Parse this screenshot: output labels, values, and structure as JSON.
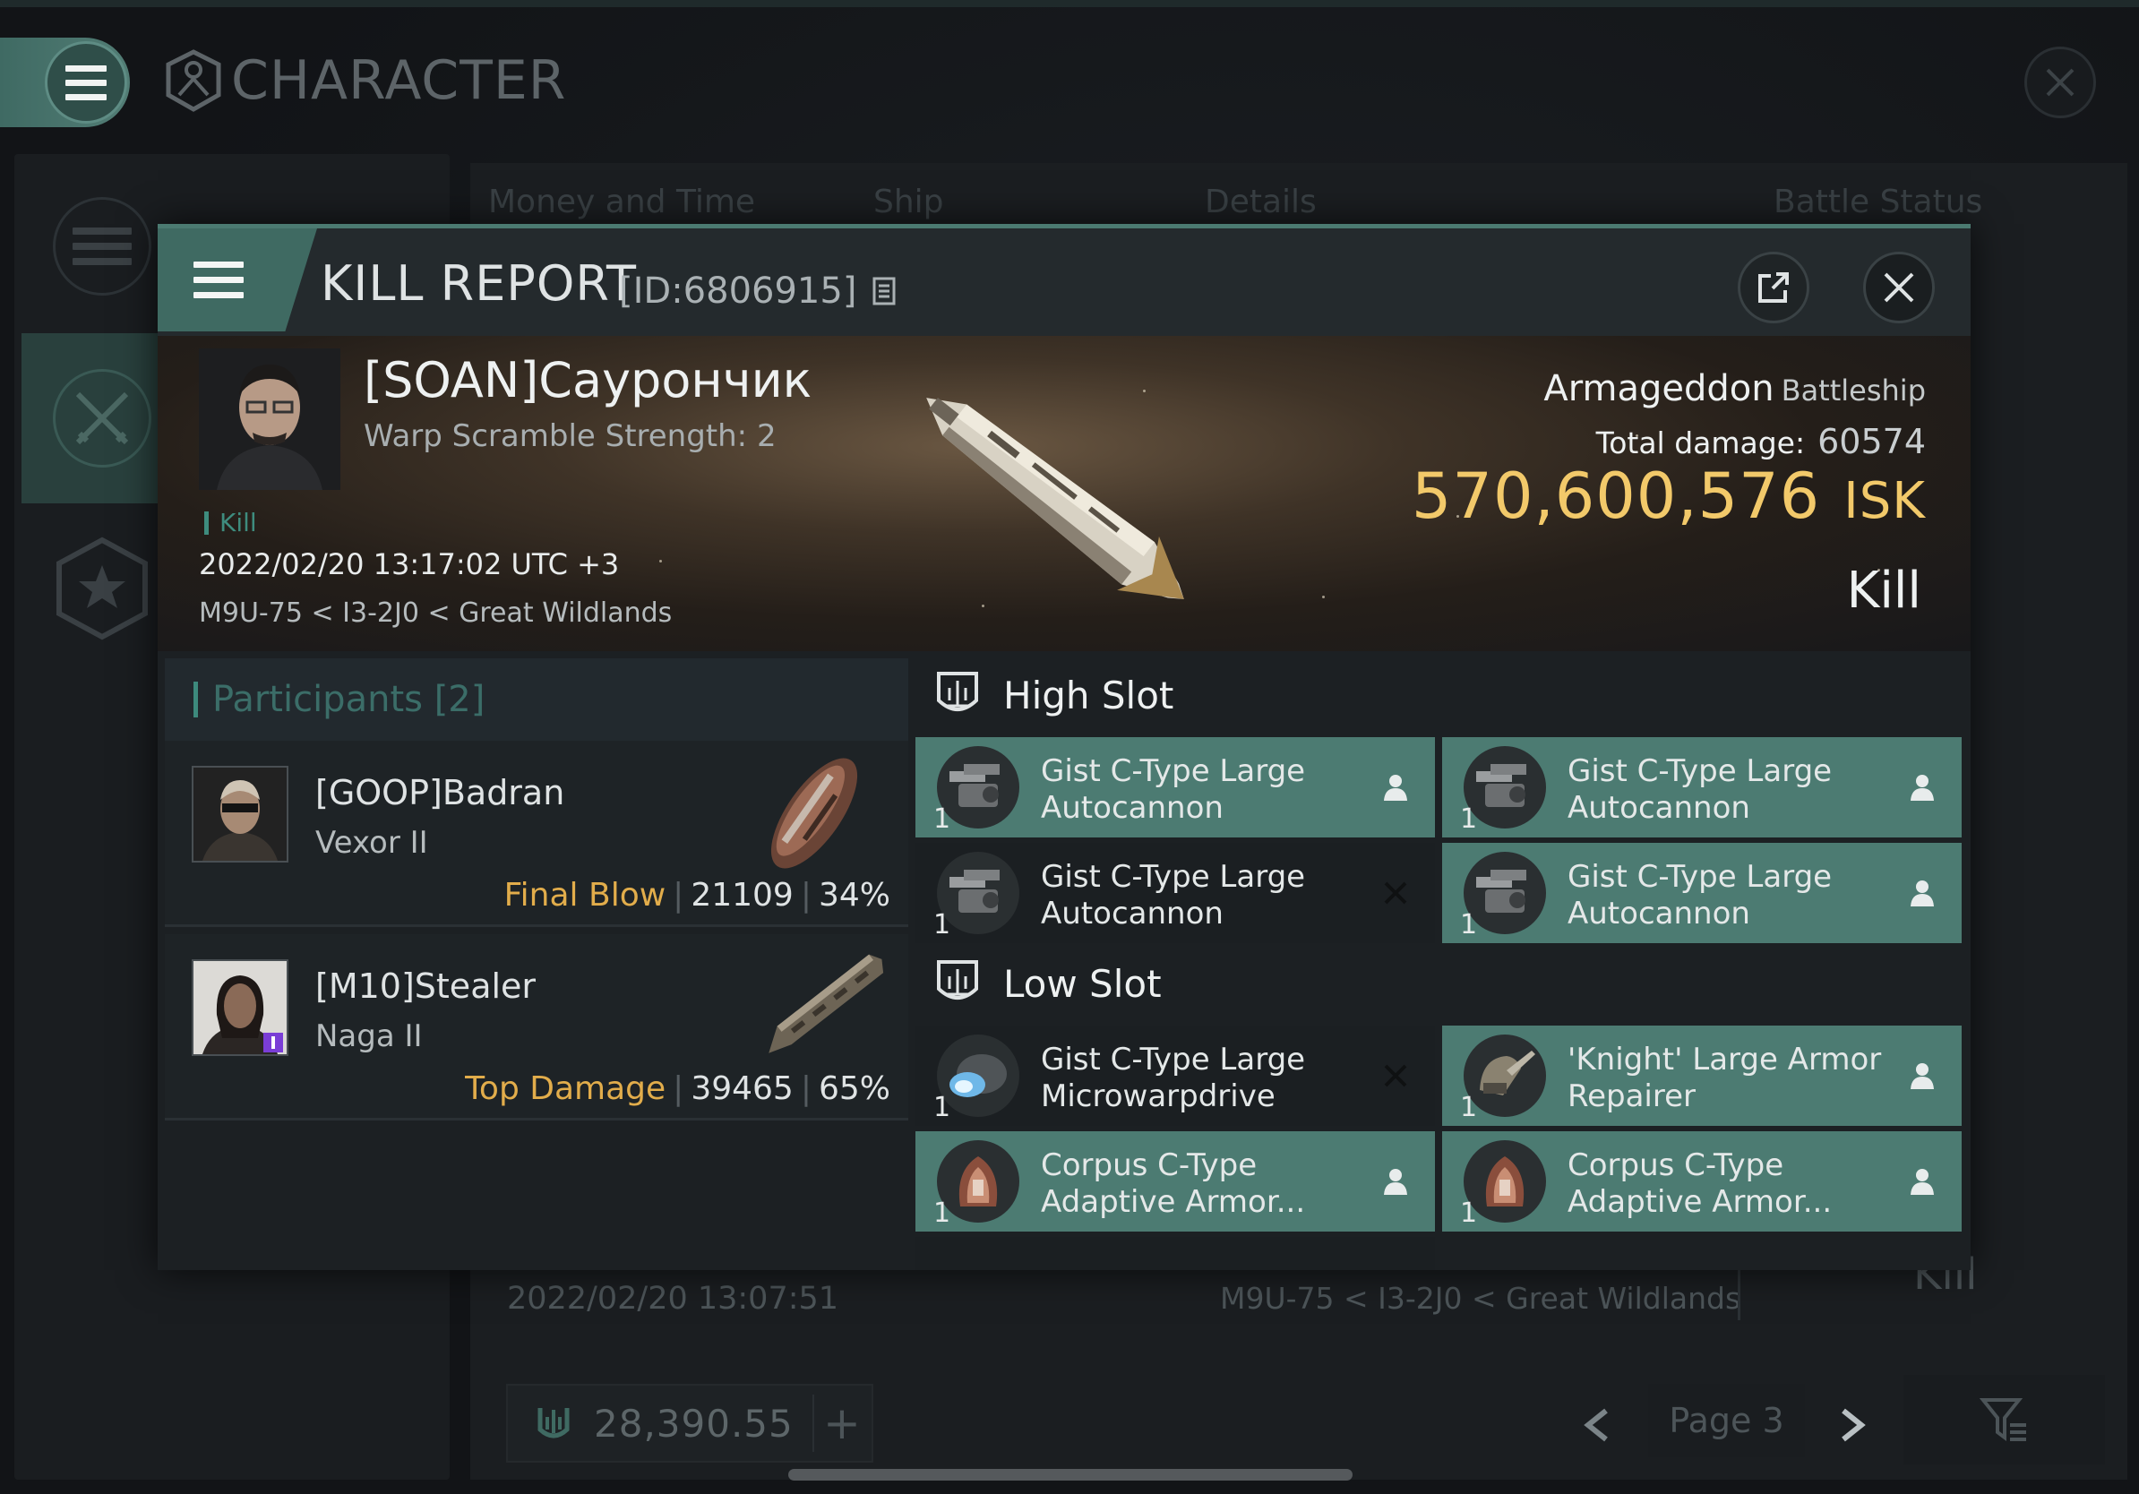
{
  "background": {
    "window_title": "CHARACTER",
    "table_headers": [
      "Money and Time",
      "Ship",
      "Details",
      "Battle Status"
    ],
    "row": {
      "date": "2022/02/20 13:07:51",
      "location": "M9U-75 < I3-2J0 < Great Wildlands",
      "result": "Kill"
    },
    "wallet_amount": "28,390.55",
    "wallet_add_label": "+",
    "page_label": "Page 3"
  },
  "kill_report": {
    "title": "KILL REPORT",
    "id_label": "[ID:6806915]",
    "victim": {
      "name": "[SOAN]Сауpончик",
      "warp_scramble": "Warp Scramble Strength: 2",
      "tag": "Kill",
      "datetime": "2022/02/20 13:17:02 UTC +3",
      "location": "M9U-75 < I3-2J0 < Great Wildlands"
    },
    "ship": {
      "name": "Armageddon",
      "class": "Battleship",
      "total_damage_label": "Total damage:",
      "total_damage": "60574",
      "value": "570,600,576",
      "currency": "ISK",
      "result": "Kill"
    },
    "participants": {
      "label": "Participants",
      "count": "[2]",
      "rows": [
        {
          "name": "[GOOP]Badran",
          "ship": "Vexor II",
          "role": "Final Blow",
          "damage": "21109",
          "percent": "34%"
        },
        {
          "name": "[M10]Stealer",
          "ship": "Naga II",
          "role": "Top Damage",
          "damage": "39465",
          "percent": "65%"
        }
      ]
    },
    "high_slot": {
      "label": "High Slot",
      "modules": [
        {
          "name": "Gist C-Type Large Autocannon",
          "qty": "1",
          "state": "dropped"
        },
        {
          "name": "Gist C-Type Large Autocannon",
          "qty": "1",
          "state": "dropped"
        },
        {
          "name": "Gist C-Type Large Autocannon",
          "qty": "1",
          "state": "destroyed"
        },
        {
          "name": "Gist C-Type Large Autocannon",
          "qty": "1",
          "state": "dropped"
        }
      ]
    },
    "low_slot": {
      "label": "Low Slot",
      "modules": [
        {
          "name": "Gist C-Type Large Microwarpdrive",
          "qty": "1",
          "state": "destroyed"
        },
        {
          "name": "'Knight' Large Armor Repairer",
          "qty": "1",
          "state": "dropped"
        },
        {
          "name": "Corpus C-Type Adaptive Armor...",
          "qty": "1",
          "state": "dropped"
        },
        {
          "name": "Corpus C-Type Adaptive Armor...",
          "qty": "1",
          "state": "dropped"
        }
      ]
    }
  },
  "colors": {
    "accent_teal": "#4c7b72",
    "isk_gold": "#f2c96a",
    "role_orange": "#e2ad4b",
    "participants_label": "#3b6d68"
  },
  "icons": {
    "menu": "hamburger-icon",
    "close": "close-icon",
    "share": "share-icon",
    "dropped_state": "person-icon",
    "destroyed_state": "x-icon",
    "slot": "slot-shield-icon"
  }
}
